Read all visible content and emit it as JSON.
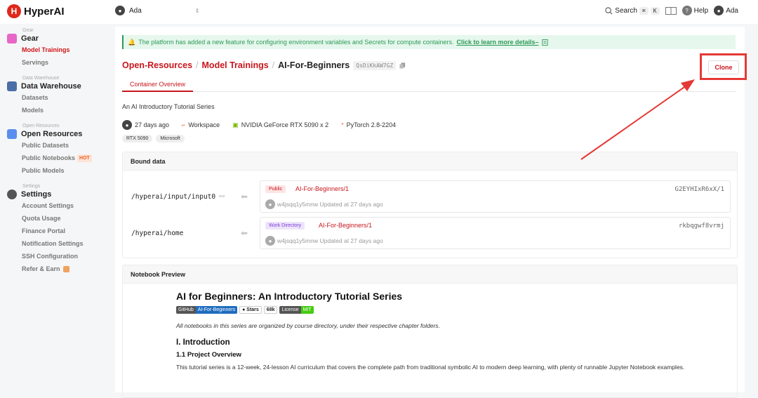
{
  "brand": {
    "name": "HyperAI"
  },
  "topbar": {
    "user": "Ada",
    "search_label": "Search",
    "kbd": [
      "⌘",
      "K"
    ],
    "help_label": "Help",
    "account_name": "Ada"
  },
  "sidebar": {
    "groups": [
      {
        "caption": "Gear",
        "title": "Gear",
        "items": [
          {
            "label": "Model Trainings",
            "active": true
          },
          {
            "label": "Servings"
          }
        ]
      },
      {
        "caption": "Data Warehouse",
        "title": "Data Warehouse",
        "items": [
          {
            "label": "Datasets"
          },
          {
            "label": "Models"
          }
        ]
      },
      {
        "caption": "Open Resources",
        "title": "Open Resources",
        "items": [
          {
            "label": "Public Datasets"
          },
          {
            "label": "Public Notebooks",
            "badge": "HOT"
          },
          {
            "label": "Public Models"
          }
        ]
      },
      {
        "caption": "Settings",
        "title": "Settings",
        "items": [
          {
            "label": "Account Settings"
          },
          {
            "label": "Quota Usage"
          },
          {
            "label": "Finance Portal"
          },
          {
            "label": "Notification Settings"
          },
          {
            "label": "SSH Configuration"
          },
          {
            "label": "Refer & Earn"
          }
        ]
      }
    ]
  },
  "notice": {
    "text": "The platform has added a new feature for configuring environment variables and Secrets for compute containers.",
    "link": "Click to learn more details–"
  },
  "breadcrumb": {
    "root": "Open-Resources",
    "section": "Model Trainings",
    "current": "AI-For-Beginners",
    "id": "QsDiKkAW7GZ"
  },
  "clone_label": "Clone",
  "tabs": [
    "Container Overview"
  ],
  "overview": {
    "description": "An AI Introductory Tutorial Series",
    "age": "27 days ago",
    "workspace": "Workspace",
    "gpu": "NVIDIA GeForce RTX 5090 x 2",
    "framework": "PyTorch 2.8-2204",
    "tags": [
      "RTX 5090",
      "Microsoft"
    ]
  },
  "bound_data": {
    "title": "Bound data",
    "rows": [
      {
        "path": "/hyperai/input/input0",
        "badge": "Public",
        "name": "AI-For-Beginners/1",
        "hash": "G2EYHIxR6xX/1",
        "user": "w4jsqq1y5mnw Updated at 27 days ago"
      },
      {
        "path": "/hyperai/home",
        "badge": "Work Directory",
        "name": "AI-For-Beginners/1",
        "hash": "rkbqgwf8vrmj",
        "user": "w4jsqq1y5mnw Updated at 27 days ago"
      }
    ]
  },
  "notebook": {
    "title": "Notebook Preview",
    "heading": "AI for Beginners: An Introductory Tutorial Series",
    "shields": {
      "github_k": "GitHub",
      "github_v": "AI-For-Beginners",
      "stars": "Stars",
      "stars_v": "68k",
      "license_k": "License",
      "license_v": "MIT"
    },
    "italic": "All notebooks in this series are organized by course directory, under their respective chapter folders.",
    "h2": "I. Introduction",
    "h3": "1.1 Project Overview",
    "para": "This tutorial series is a 12-week, 24-lesson AI curriculum that covers the complete path from traditional symbolic AI to modern deep learning, with plenty of runnable Jupyter Notebook examples."
  },
  "colors": {
    "accent": "#c8161d",
    "notice": "#2c9a57",
    "annotation": "#e53935"
  }
}
